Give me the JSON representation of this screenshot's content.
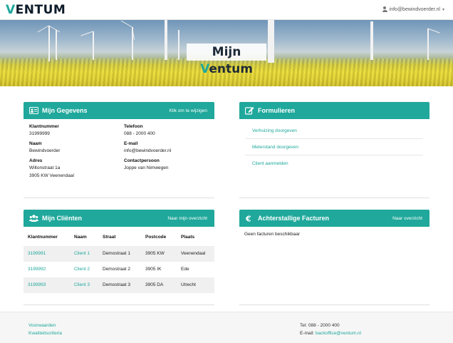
{
  "header": {
    "logo_v": "V",
    "logo_rest": "ENTUM",
    "user_email": "info@bewindvoerder.nl",
    "user_caret": "▾"
  },
  "hero": {
    "title_m": "Mijn ",
    "title_v": "V",
    "title_rest": "entum"
  },
  "gegevens": {
    "title": "Mijn Gegevens",
    "action": "Klik om te wijzigen",
    "fields": {
      "klantnummer_label": "Klantnummer",
      "klantnummer": "31999999",
      "telefoon_label": "Telefoon",
      "telefoon": "088 - 2000 400",
      "naam_label": "Naam",
      "naam": "Bewindvoerder",
      "email_label": "E-mail",
      "email": "info@bewindvoerder.nl",
      "adres_label": "Adres",
      "adres_line1": "Wiltonstraat 1a",
      "adres_line2": "3905 KW Veenendaal",
      "contact_label": "Contactpersoon",
      "contact": "Joppe van Nimwegen"
    }
  },
  "formulieren": {
    "title": "Formulieren",
    "links": [
      "Verhuizing doorgeven",
      "Meterstand doorgeven",
      "Client aanmelden"
    ]
  },
  "clienten": {
    "title": "Mijn Cliënten",
    "action": "Naar mijn overzicht",
    "columns": [
      "Klantnummer",
      "Naam",
      "Straat",
      "Postcode",
      "Plaats"
    ],
    "rows": [
      [
        "3199991",
        "Client 1",
        "Demostraat 1",
        "3905 KW",
        "Veenendaal"
      ],
      [
        "3199992",
        "Client 2",
        "Demostraat 2",
        "3905 IK",
        "Ede"
      ],
      [
        "3199993",
        "Client 3",
        "Demostraat 3",
        "3905 DA",
        "Utrecht"
      ]
    ]
  },
  "facturen": {
    "title": "Achterstallige Facturen",
    "action": "Naar overzicht",
    "empty": "Geen facturen beschikbaar"
  },
  "footer": {
    "links": [
      "Voorwaarden",
      "Kwaliteitscriteria"
    ],
    "phone": "Tel: 088 - 2000 400",
    "email_label": "E-mail: ",
    "email": "backoffice@ventum.nl"
  },
  "colors": {
    "accent": "#1fa89b",
    "dark": "#0d1b2a"
  }
}
